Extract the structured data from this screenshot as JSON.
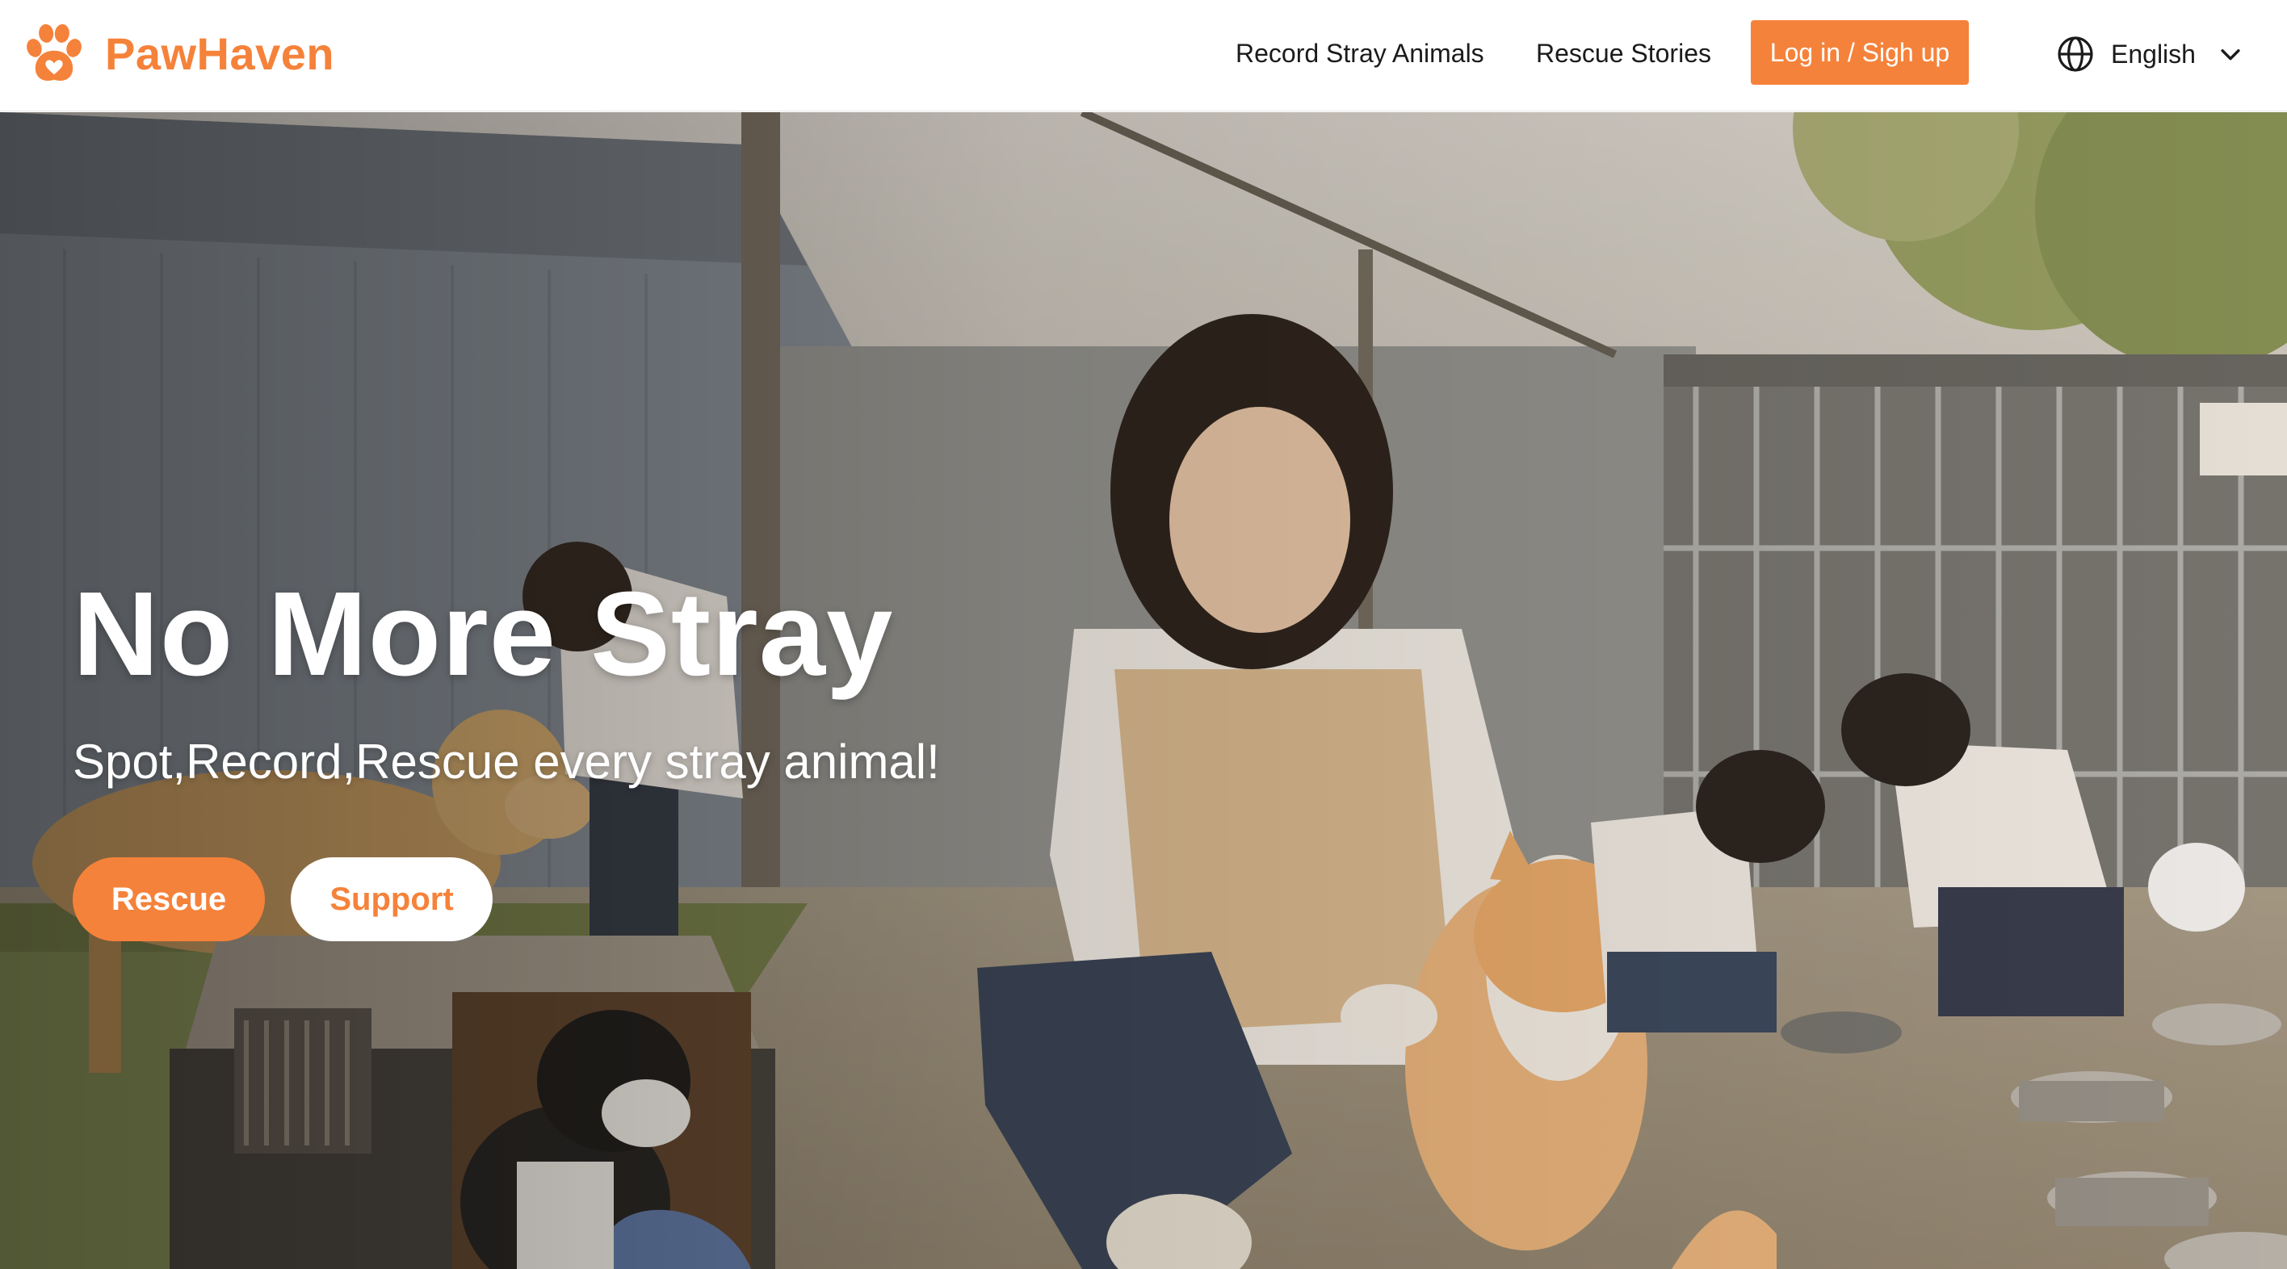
{
  "header": {
    "brand_name": "PawHaven",
    "nav": {
      "record_stray_animals": "Record Stray Animals",
      "rescue_stories": "Rescue Stories"
    },
    "login_button": "Log in / Sigh up",
    "language": {
      "selected": "English",
      "icon": "globe-icon",
      "dropdown_icon": "chevron-down-icon"
    }
  },
  "hero": {
    "title": "No More Stray",
    "subtitle": "Spot,Record,Rescue every stray animal!",
    "buttons": {
      "rescue": "Rescue",
      "support": "Support"
    }
  },
  "colors": {
    "brand_orange": "#f5823a",
    "text_dark": "#1b1b1b",
    "white": "#ffffff"
  }
}
